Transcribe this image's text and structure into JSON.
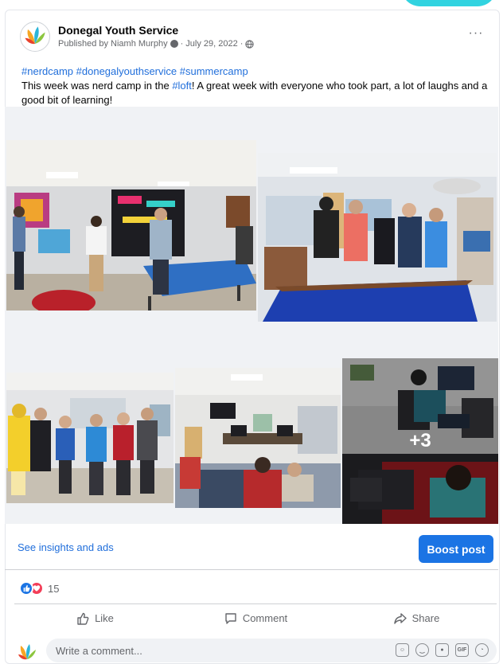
{
  "post": {
    "page_name": "Donegal Youth Service",
    "published_by": "Published by Niamh Murphy",
    "date": "· July 29, 2022 ·",
    "more_label": "···",
    "hashtags": "#nerdcamp #donegalyouthservice #summercamp",
    "text_before_link": "This week was nerd camp in the ",
    "link_text": "#loft",
    "text_after_link": "! A great week with everyone who took part, a lot of laughs and a good bit of learning!",
    "more_photos": "+3"
  },
  "insights": {
    "link_label": "See insights and ads",
    "boost_label": "Boost post"
  },
  "reactions": {
    "count": "15"
  },
  "actions": {
    "like": "Like",
    "comment": "Comment",
    "share": "Share"
  },
  "comment": {
    "placeholder": "Write a comment..."
  },
  "colors": {
    "brand_blue": "#1b74e4",
    "link_blue": "#216fdb",
    "love_red": "#f33e58",
    "pool_blue": "#1d3fb0"
  }
}
